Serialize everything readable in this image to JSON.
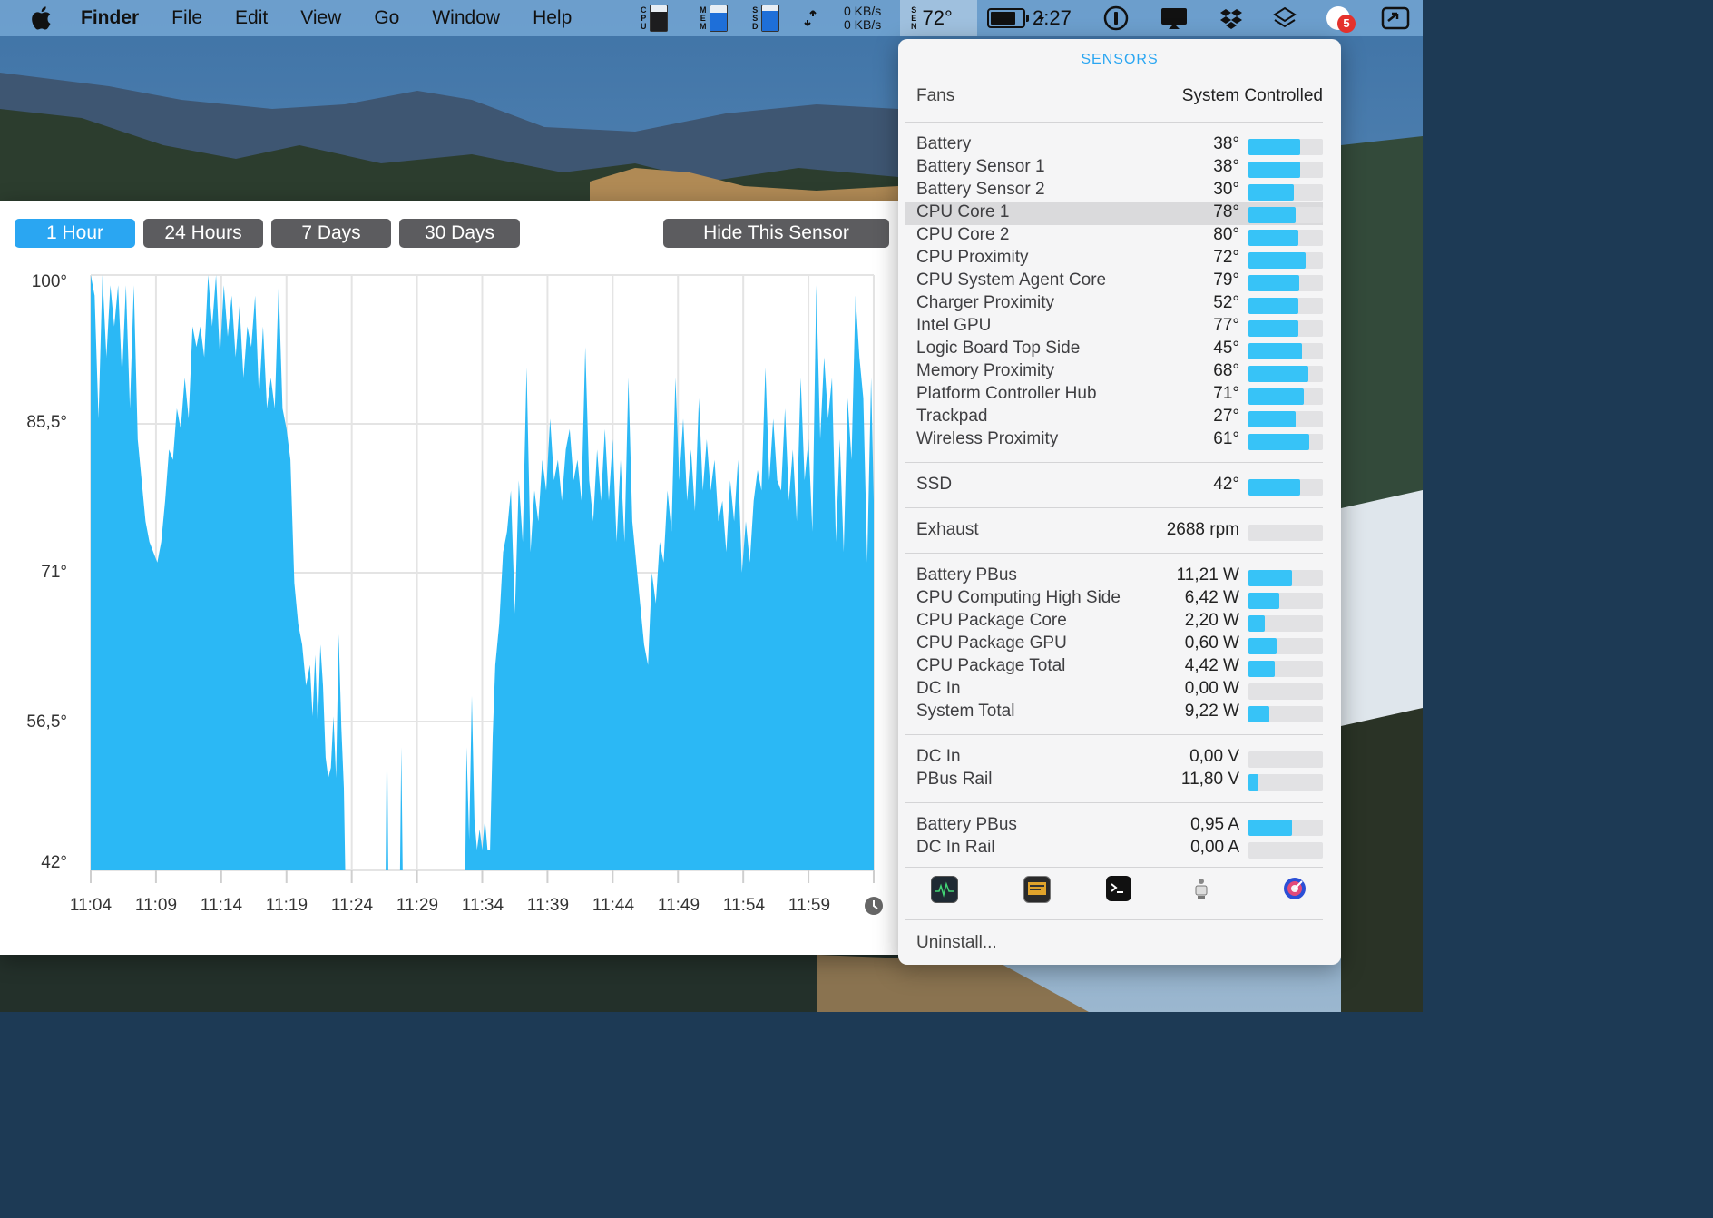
{
  "menubar": {
    "app_name": "Finder",
    "menus": [
      "File",
      "Edit",
      "View",
      "Go",
      "Window",
      "Help"
    ],
    "cpu_label": [
      "C",
      "P",
      "U"
    ],
    "mem_label": [
      "M",
      "E",
      "M"
    ],
    "ssd_label": [
      "S",
      "S",
      "D"
    ],
    "sen_label": [
      "S",
      "E",
      "N"
    ],
    "net_up": "0 KB/s",
    "net_down": "0 KB/s",
    "temp_reading": "72°",
    "clock": "2:27",
    "notification_count": "5",
    "cpu_meter_level": 0.75,
    "mem_meter_level": 0.7,
    "ssd_meter_level": 0.8,
    "battery_level": 0.85
  },
  "graph": {
    "range_buttons": [
      "1 Hour",
      "24 Hours",
      "7 Days",
      "30 Days"
    ],
    "active_range": "1 Hour",
    "hide_button": "Hide This Sensor",
    "y_labels": [
      "100°",
      "85,5°",
      "71°",
      "56,5°",
      "42°"
    ],
    "x_labels": [
      "11:04",
      "11:09",
      "11:14",
      "11:19",
      "11:24",
      "11:29",
      "11:34",
      "11:39",
      "11:44",
      "11:49",
      "11:54",
      "11:59"
    ],
    "fill_color": "#2bb8f5"
  },
  "chart_data": {
    "type": "area",
    "ylim": [
      42,
      100
    ],
    "x_range": [
      "11:04",
      "12:04"
    ],
    "series": [
      {
        "values": [
          [
            0,
            100
          ],
          [
            0.3,
            98
          ],
          [
            0.6,
            86
          ],
          [
            0.9,
            100
          ],
          [
            1.2,
            92
          ],
          [
            1.5,
            99
          ],
          [
            1.8,
            95
          ],
          [
            2.1,
            99
          ],
          [
            2.4,
            90
          ],
          [
            2.7,
            99
          ],
          [
            3.0,
            87
          ],
          [
            3.3,
            99
          ],
          [
            3.6,
            84
          ],
          [
            3.9,
            80
          ],
          [
            4.2,
            76
          ],
          [
            4.5,
            74
          ],
          [
            4.8,
            73
          ],
          [
            5.1,
            72
          ],
          [
            5.4,
            74
          ],
          [
            5.7,
            78
          ],
          [
            6.0,
            83
          ],
          [
            6.3,
            82
          ],
          [
            6.6,
            87
          ],
          [
            6.9,
            85
          ],
          [
            7.2,
            90
          ],
          [
            7.5,
            86
          ],
          [
            7.8,
            95
          ],
          [
            8.1,
            93
          ],
          [
            8.4,
            95
          ],
          [
            8.7,
            92
          ],
          [
            9.0,
            100
          ],
          [
            9.3,
            95
          ],
          [
            9.6,
            100
          ],
          [
            9.9,
            92
          ],
          [
            10.2,
            99
          ],
          [
            10.5,
            94
          ],
          [
            10.8,
            98
          ],
          [
            11.1,
            92
          ],
          [
            11.4,
            97
          ],
          [
            11.7,
            90
          ],
          [
            12.0,
            95
          ],
          [
            12.3,
            93
          ],
          [
            12.6,
            98
          ],
          [
            12.9,
            88
          ],
          [
            13.2,
            95
          ],
          [
            13.5,
            87
          ],
          [
            13.8,
            90
          ],
          [
            14.1,
            87
          ],
          [
            14.4,
            99
          ],
          [
            14.7,
            87
          ],
          [
            15.0,
            85
          ],
          [
            15.3,
            82
          ],
          [
            15.6,
            70
          ],
          [
            15.9,
            66
          ],
          [
            16.2,
            64
          ],
          [
            16.5,
            60
          ],
          [
            16.8,
            62
          ],
          [
            17.0,
            57
          ],
          [
            17.2,
            63
          ],
          [
            17.4,
            56
          ],
          [
            17.6,
            64
          ],
          [
            17.8,
            60
          ],
          [
            18.0,
            53
          ],
          [
            18.2,
            51
          ],
          [
            18.4,
            52
          ],
          [
            18.6,
            57
          ],
          [
            18.8,
            51
          ],
          [
            19.0,
            65
          ],
          [
            19.2,
            56
          ],
          [
            19.4,
            50
          ],
          [
            19.5,
            42
          ],
          [
            22.6,
            42
          ],
          [
            22.7,
            57
          ],
          [
            22.8,
            42
          ],
          [
            23.7,
            42
          ],
          [
            23.8,
            54
          ],
          [
            23.9,
            42
          ],
          [
            28.7,
            42
          ],
          [
            28.8,
            54
          ],
          [
            29.0,
            45
          ],
          [
            29.2,
            59
          ],
          [
            29.4,
            47
          ],
          [
            29.6,
            44
          ],
          [
            29.8,
            46
          ],
          [
            30.0,
            44
          ],
          [
            30.2,
            47
          ],
          [
            30.4,
            44
          ],
          [
            30.6,
            44
          ],
          [
            30.8,
            55
          ],
          [
            31.0,
            62
          ],
          [
            31.3,
            66
          ],
          [
            31.6,
            73
          ],
          [
            31.9,
            75
          ],
          [
            32.2,
            79
          ],
          [
            32.5,
            67
          ],
          [
            32.8,
            80
          ],
          [
            33.1,
            74
          ],
          [
            33.4,
            91
          ],
          [
            33.7,
            73
          ],
          [
            34.0,
            79
          ],
          [
            34.3,
            76
          ],
          [
            34.6,
            82
          ],
          [
            34.9,
            79
          ],
          [
            35.2,
            86
          ],
          [
            35.5,
            80
          ],
          [
            35.8,
            82
          ],
          [
            36.1,
            78
          ],
          [
            36.4,
            83
          ],
          [
            36.7,
            85
          ],
          [
            37.0,
            80
          ],
          [
            37.3,
            82
          ],
          [
            37.6,
            78
          ],
          [
            37.9,
            93
          ],
          [
            38.2,
            80
          ],
          [
            38.5,
            76
          ],
          [
            38.8,
            83
          ],
          [
            39.1,
            78
          ],
          [
            39.4,
            85
          ],
          [
            39.7,
            78
          ],
          [
            40.0,
            84
          ],
          [
            40.3,
            74
          ],
          [
            40.6,
            82
          ],
          [
            40.9,
            74
          ],
          [
            41.2,
            90
          ],
          [
            41.5,
            76
          ],
          [
            41.8,
            72
          ],
          [
            42.1,
            68
          ],
          [
            42.4,
            64
          ],
          [
            42.7,
            62
          ],
          [
            43.0,
            71
          ],
          [
            43.3,
            68
          ],
          [
            43.6,
            74
          ],
          [
            43.9,
            72
          ],
          [
            44.2,
            79
          ],
          [
            44.5,
            75
          ],
          [
            44.8,
            90
          ],
          [
            45.1,
            80
          ],
          [
            45.4,
            86
          ],
          [
            45.7,
            78
          ],
          [
            46.0,
            83
          ],
          [
            46.3,
            77
          ],
          [
            46.6,
            88
          ],
          [
            46.9,
            79
          ],
          [
            47.2,
            84
          ],
          [
            47.5,
            79
          ],
          [
            47.8,
            82
          ],
          [
            48.1,
            76
          ],
          [
            48.4,
            78
          ],
          [
            48.7,
            73
          ],
          [
            49.0,
            80
          ],
          [
            49.3,
            76
          ],
          [
            49.6,
            82
          ],
          [
            49.9,
            71
          ],
          [
            50.2,
            76
          ],
          [
            50.5,
            72
          ],
          [
            50.8,
            78
          ],
          [
            51.1,
            81
          ],
          [
            51.4,
            79
          ],
          [
            51.7,
            91
          ],
          [
            52.0,
            80
          ],
          [
            52.3,
            86
          ],
          [
            52.6,
            80
          ],
          [
            52.9,
            79
          ],
          [
            53.2,
            87
          ],
          [
            53.5,
            78
          ],
          [
            53.8,
            83
          ],
          [
            54.1,
            76
          ],
          [
            54.4,
            90
          ],
          [
            54.7,
            80
          ],
          [
            55.0,
            84
          ],
          [
            55.3,
            75
          ],
          [
            55.6,
            99
          ],
          [
            55.9,
            84
          ],
          [
            56.2,
            92
          ],
          [
            56.5,
            86
          ],
          [
            56.8,
            90
          ],
          [
            57.1,
            74
          ],
          [
            57.4,
            84
          ],
          [
            57.7,
            73
          ],
          [
            58.0,
            88
          ],
          [
            58.3,
            82
          ],
          [
            58.6,
            98
          ],
          [
            58.9,
            92
          ],
          [
            59.2,
            88
          ],
          [
            59.5,
            72
          ],
          [
            59.8,
            90
          ],
          [
            60.0,
            78
          ]
        ]
      }
    ]
  },
  "panel": {
    "title": "SENSORS",
    "fans_label": "Fans",
    "fans_value": "System Controlled",
    "groups": [
      [
        {
          "name": "Battery",
          "value": "38°",
          "level": 0.7
        },
        {
          "name": "Battery Sensor 1",
          "value": "38°",
          "level": 0.7
        },
        {
          "name": "Battery Sensor 2",
          "value": "30°",
          "level": 0.61
        },
        {
          "name": "CPU Core 1",
          "value": "78°",
          "level": 0.63,
          "highlight": true
        },
        {
          "name": "CPU Core 2",
          "value": "80°",
          "level": 0.67
        },
        {
          "name": "CPU Proximity",
          "value": "72°",
          "level": 0.77
        },
        {
          "name": "CPU System Agent Core",
          "value": "79°",
          "level": 0.68
        },
        {
          "name": "Charger Proximity",
          "value": "52°",
          "level": 0.67
        },
        {
          "name": "Intel GPU",
          "value": "77°",
          "level": 0.67
        },
        {
          "name": "Logic Board Top Side",
          "value": "45°",
          "level": 0.72
        },
        {
          "name": "Memory Proximity",
          "value": "68°",
          "level": 0.8
        },
        {
          "name": "Platform Controller Hub",
          "value": "71°",
          "level": 0.74
        },
        {
          "name": "Trackpad",
          "value": "27°",
          "level": 0.63
        },
        {
          "name": "Wireless Proximity",
          "value": "61°",
          "level": 0.82
        }
      ],
      [
        {
          "name": "SSD",
          "value": "42°",
          "level": 0.7
        }
      ],
      [
        {
          "name": "Exhaust",
          "value": "2688 rpm",
          "level": 0.0
        }
      ],
      [
        {
          "name": "Battery PBus",
          "value": "11,21 W",
          "level": 0.59
        },
        {
          "name": "CPU Computing High Side",
          "value": "6,42 W",
          "level": 0.41
        },
        {
          "name": "CPU Package Core",
          "value": "2,20 W",
          "level": 0.22
        },
        {
          "name": "CPU Package GPU",
          "value": "0,60 W",
          "level": 0.38
        },
        {
          "name": "CPU Package Total",
          "value": "4,42 W",
          "level": 0.35
        },
        {
          "name": "DC In",
          "value": "0,00 W",
          "level": 0.0
        },
        {
          "name": "System Total",
          "value": "9,22 W",
          "level": 0.28
        }
      ],
      [
        {
          "name": "DC In",
          "value": "0,00 V",
          "level": 0.0
        },
        {
          "name": "PBus Rail",
          "value": "11,80 V",
          "level": 0.13
        }
      ],
      [
        {
          "name": "Battery PBus",
          "value": "0,95 A",
          "level": 0.59
        },
        {
          "name": "DC In Rail",
          "value": "0,00 A",
          "level": 0.0
        }
      ]
    ],
    "uninstall": "Uninstall..."
  }
}
